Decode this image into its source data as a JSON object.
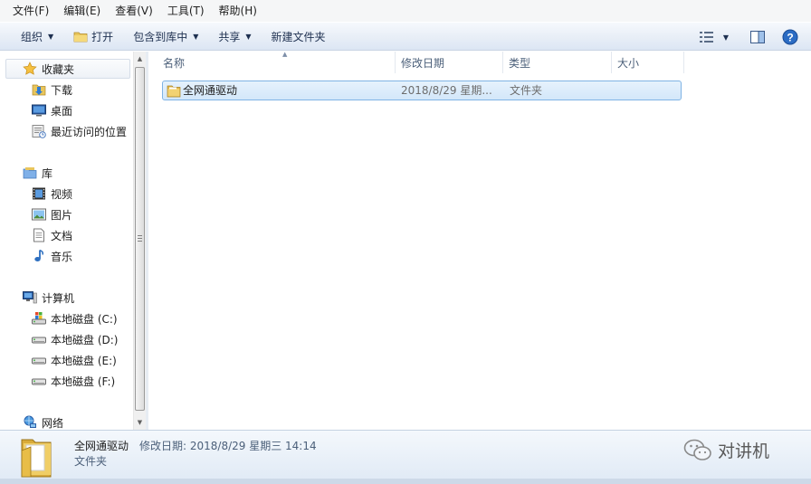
{
  "menu": [
    "文件(F)",
    "编辑(E)",
    "查看(V)",
    "工具(T)",
    "帮助(H)"
  ],
  "toolbar": {
    "organize": "组织",
    "open": "打开",
    "include_library": "包含到库中",
    "share": "共享",
    "new_folder": "新建文件夹"
  },
  "nav": {
    "favorites": {
      "title": "收藏夹",
      "items": [
        "下载",
        "桌面",
        "最近访问的位置"
      ]
    },
    "libraries": {
      "title": "库",
      "items": [
        "视频",
        "图片",
        "文档",
        "音乐"
      ]
    },
    "computer": {
      "title": "计算机",
      "items": [
        "本地磁盘 (C:)",
        "本地磁盘 (D:)",
        "本地磁盘 (E:)",
        "本地磁盘 (F:)"
      ]
    },
    "network": {
      "title": "网络"
    }
  },
  "columns": [
    "名称",
    "修改日期",
    "类型",
    "大小"
  ],
  "rows": [
    {
      "name": "全网通驱动",
      "date": "2018/8/29 星期...",
      "type": "文件夹",
      "size": ""
    }
  ],
  "status": {
    "name": "全网通驱动",
    "meta": "修改日期: 2018/8/29 星期三 14:14",
    "type": "文件夹"
  },
  "watermark": "对讲机",
  "colors": {
    "accent": "#1f5da8",
    "selection": "#d3e7fa",
    "folder": "#e7c35a"
  }
}
